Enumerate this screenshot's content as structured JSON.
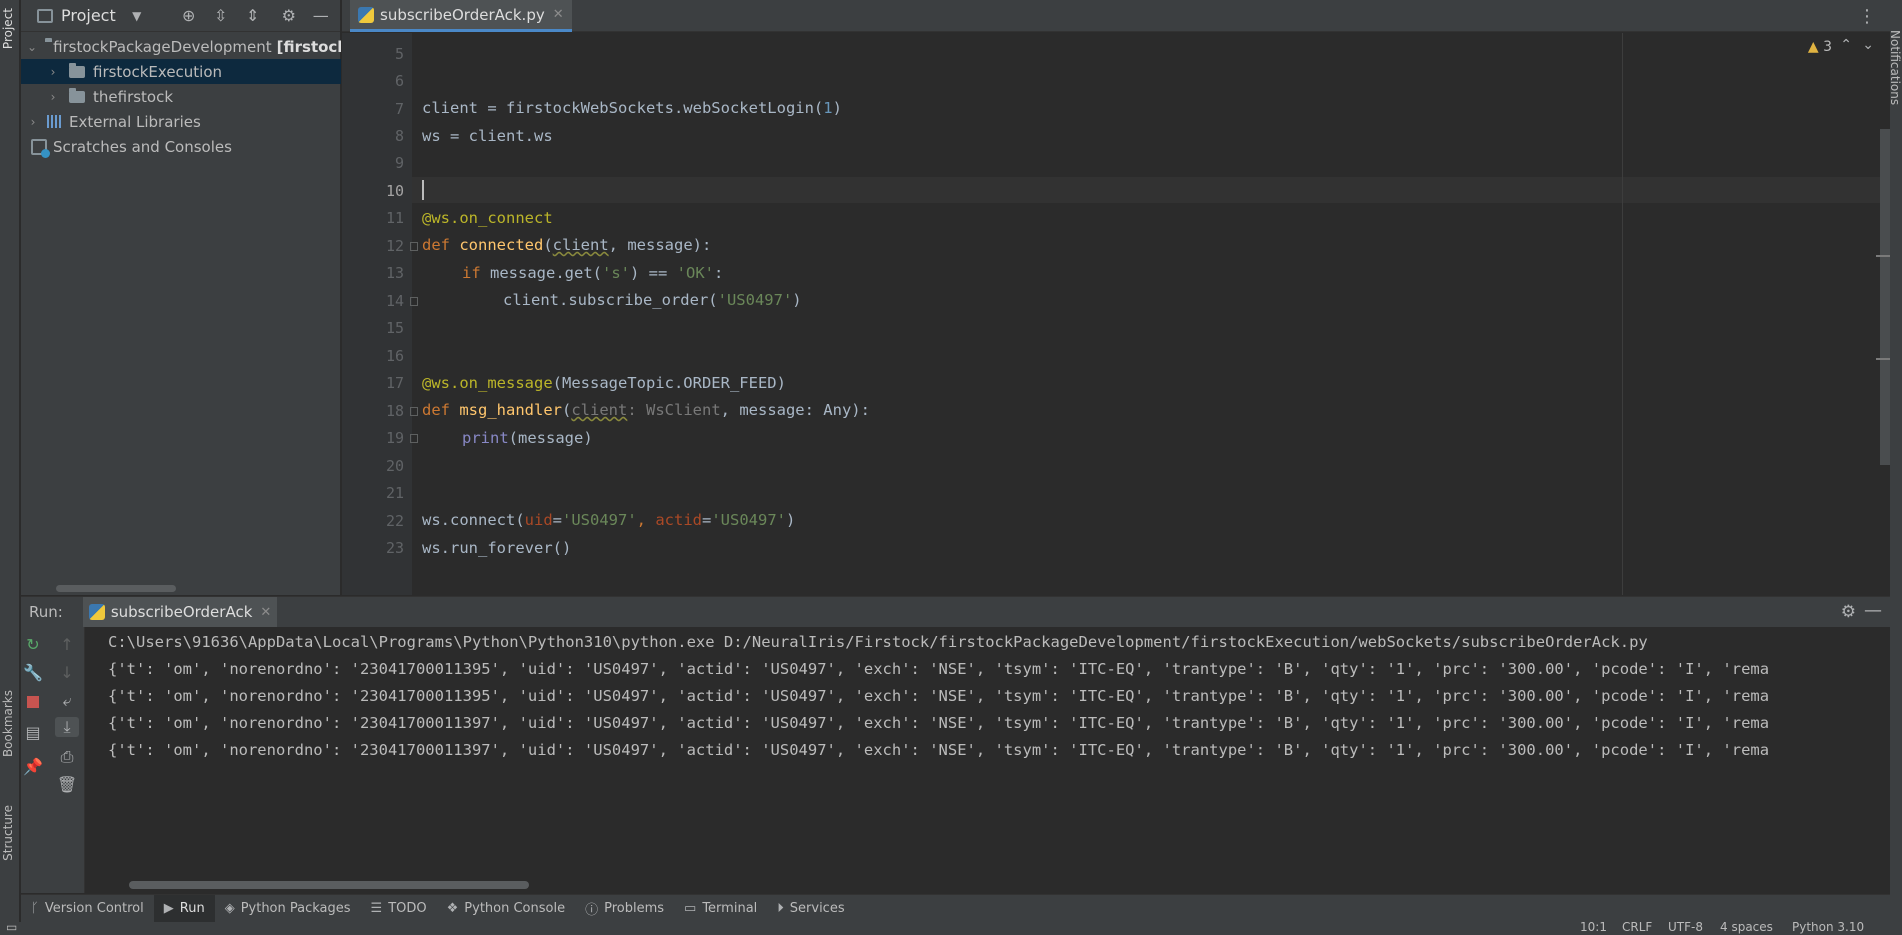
{
  "left_strip": {
    "project": "Project",
    "bookmarks": "Bookmarks",
    "structure": "Structure"
  },
  "right_strip": {
    "notifications": "Notifications"
  },
  "project_panel": {
    "title": "Project",
    "tree": [
      {
        "label": "firstockPackageDevelopment",
        "suffix": "[firstockP",
        "expanded": true
      },
      {
        "label": "firstockExecution",
        "selected": true
      },
      {
        "label": "thefirstock"
      },
      {
        "label": "External Libraries"
      },
      {
        "label": "Scratches and Consoles"
      }
    ]
  },
  "editor": {
    "tab_label": "subscribeOrderAck.py",
    "warnings_count": "3",
    "line_numbers": [
      "5",
      "6",
      "7",
      "8",
      "9",
      "10",
      "11",
      "12",
      "13",
      "14",
      "15",
      "16",
      "17",
      "18",
      "19",
      "20",
      "21",
      "22",
      "23"
    ],
    "current_line": "10",
    "code": {
      "l7_a": "client = firstockWebSockets.webSocketLogin(",
      "l7_num": "1",
      "l7_b": ")",
      "l8": "ws = client.ws",
      "l11": "@ws.on_connect",
      "l12_kw": "def ",
      "l12_fn": "connected",
      "l12_a": "(",
      "l12_p1": "client",
      "l12_b": ", message):",
      "l13_kw": "if ",
      "l13_a": "message.get(",
      "l13_s1": "'s'",
      "l13_b": ") == ",
      "l13_s2": "'OK'",
      "l13_c": ":",
      "l14_a": "client.subscribe_order(",
      "l14_s": "'US0497'",
      "l14_b": ")",
      "l17_deco": "@ws.on_message",
      "l17_b": "(MessageTopic.ORDER_FEED)",
      "l18_kw": "def ",
      "l18_fn": "msg_handler",
      "l18_a": "(",
      "l18_p1": "client",
      "l18_hint": ": WsClient",
      "l18_b": ", message: Any):",
      "l19_fn": "print",
      "l19_b": "(message)",
      "l22_a": "ws.connect(",
      "l22_p1": "uid",
      "l22_eq1": "=",
      "l22_s1": "'US0497'",
      "l22_c": ", ",
      "l22_p2": "actid",
      "l22_eq2": "=",
      "l22_s2": "'US0497'",
      "l22_b": ")",
      "l23": "ws.run_forever()"
    }
  },
  "run_panel": {
    "label": "Run:",
    "tab_label": "subscribeOrderAck",
    "console_lines": [
      "C:\\Users\\91636\\AppData\\Local\\Programs\\Python\\Python310\\python.exe D:/NeuralIris/Firstock/firstockPackageDevelopment/firstockExecution/webSockets/subscribeOrderAck.py",
      "{'t': 'om', 'norenordno': '23041700011395', 'uid': 'US0497', 'actid': 'US0497', 'exch': 'NSE', 'tsym': 'ITC-EQ', 'trantype': 'B', 'qty': '1', 'prc': '300.00', 'pcode': 'I', 'rema",
      "{'t': 'om', 'norenordno': '23041700011395', 'uid': 'US0497', 'actid': 'US0497', 'exch': 'NSE', 'tsym': 'ITC-EQ', 'trantype': 'B', 'qty': '1', 'prc': '300.00', 'pcode': 'I', 'rema",
      "{'t': 'om', 'norenordno': '23041700011397', 'uid': 'US0497', 'actid': 'US0497', 'exch': 'NSE', 'tsym': 'ITC-EQ', 'trantype': 'B', 'qty': '1', 'prc': '300.00', 'pcode': 'I', 'rema",
      "{'t': 'om', 'norenordno': '23041700011397', 'uid': 'US0497', 'actid': 'US0497', 'exch': 'NSE', 'tsym': 'ITC-EQ', 'trantype': 'B', 'qty': '1', 'prc': '300.00', 'pcode': 'I', 'rema"
    ]
  },
  "bottom_tools": [
    {
      "label": "Version Control",
      "icon": "branch-icon"
    },
    {
      "label": "Run",
      "icon": "run-icon",
      "active": true
    },
    {
      "label": "Python Packages",
      "icon": "packages-icon"
    },
    {
      "label": "TODO",
      "icon": "todo-icon"
    },
    {
      "label": "Python Console",
      "icon": "python-console-icon"
    },
    {
      "label": "Problems",
      "icon": "problems-icon"
    },
    {
      "label": "Terminal",
      "icon": "terminal-icon"
    },
    {
      "label": "Services",
      "icon": "services-icon"
    }
  ],
  "status_bar": {
    "position": "10:1",
    "line_sep": "CRLF",
    "encoding": "UTF-8",
    "indent": "4 spaces",
    "interpreter": "Python 3.10"
  }
}
